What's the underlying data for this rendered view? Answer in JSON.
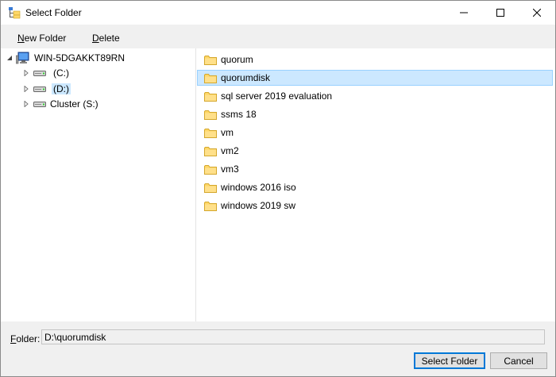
{
  "window": {
    "title": "Select Folder"
  },
  "toolbar": {
    "new_folder": {
      "accel": "N",
      "rest": "ew Folder"
    },
    "delete": {
      "accel": "D",
      "rest": "elete"
    }
  },
  "tree": {
    "root": {
      "label": "WIN-5DGAKKT89RN",
      "icon": "computer-icon",
      "expanded": true
    },
    "drives": [
      {
        "label": "(C:)",
        "icon": "drive-icon"
      },
      {
        "label": "(D:)",
        "icon": "drive-icon",
        "selected": true
      },
      {
        "label": "Cluster (S:)",
        "icon": "drive-icon"
      }
    ]
  },
  "folders": [
    {
      "label": "quorum"
    },
    {
      "label": "quorumdisk",
      "selected": true
    },
    {
      "label": "sql server 2019 evaluation"
    },
    {
      "label": "ssms 18"
    },
    {
      "label": "vm"
    },
    {
      "label": "vm2"
    },
    {
      "label": "vm3"
    },
    {
      "label": "windows 2016 iso"
    },
    {
      "label": "windows 2019 sw"
    }
  ],
  "footer": {
    "folder_label": {
      "accel": "F",
      "rest": "older:"
    },
    "folder_value": "D:\\quorumdisk",
    "select_button": "Select Folder",
    "cancel_button": "Cancel"
  },
  "colors": {
    "selection_bg": "#cce8ff",
    "selection_border": "#99d1ff",
    "folder_yellow": "#ffd767",
    "accent": "#0078d7"
  }
}
